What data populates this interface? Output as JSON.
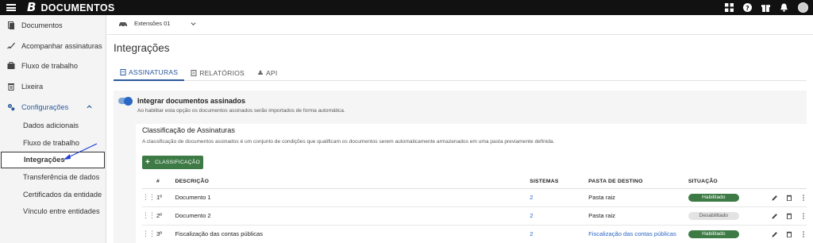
{
  "topbar": {
    "app_name": "DOCUMENTOS",
    "logo_letter": "B",
    "icons": [
      "apps-grid-icon",
      "help-icon",
      "gift-icon",
      "bell-icon",
      "user-avatar"
    ]
  },
  "sidebar": {
    "items": [
      {
        "label": "Documentos",
        "icon": "document-icon"
      },
      {
        "label": "Acompanhar assinaturas",
        "icon": "signature-icon"
      },
      {
        "label": "Fluxo de trabalho",
        "icon": "workflow-icon"
      },
      {
        "label": "Lixeira",
        "icon": "trash-icon"
      },
      {
        "label": "Configurações",
        "icon": "gears-icon"
      }
    ],
    "sub_items": [
      "Dados adicionais",
      "Fluxo de trabalho",
      "Integrações",
      "Transferência de dados",
      "Certificados da entidade",
      "Vínculo entre entidades"
    ],
    "active_sub": "Integrações"
  },
  "extension_selector": {
    "value": "Extensões 01"
  },
  "page_title": "Integrações",
  "tabs": [
    {
      "label": "ASSINATURAS",
      "icon": "document-icon",
      "active": true
    },
    {
      "label": "RELATÓRIOS",
      "icon": "report-icon",
      "active": false
    },
    {
      "label": "API",
      "icon": "api-icon",
      "active": false
    }
  ],
  "integration": {
    "title": "Integrar documentos assinados",
    "description": "Ao habilitar esta opção os documentos assinados serão importados de forma automática.",
    "enabled": true
  },
  "classification": {
    "title": "Classificação de Assinaturas",
    "description": "A classificação de documentos assinados é um conjunto de condições que qualificam os documentos serem automaticamente armazenados em uma pasta previamente definida.",
    "add_button": "CLASSIFICAÇÃO"
  },
  "table": {
    "headers": {
      "num": "#",
      "description": "DESCRIÇÃO",
      "systems": "SISTEMAS",
      "destination": "PASTA DE DESTINO",
      "status": "SITUAÇÃO"
    },
    "rows": [
      {
        "num": "1º",
        "description": "Documento 1",
        "systems": "2",
        "destination": "Pasta raiz",
        "status": "Habilitado"
      },
      {
        "num": "2º",
        "description": "Documento 2",
        "systems": "2",
        "destination": "Pasta raiz",
        "status": "Desabilitado"
      },
      {
        "num": "3º",
        "description": "Fiscalização das contas públicas",
        "systems": "2",
        "destination": "Fiscalização das contas públicas",
        "status": "Habilitado"
      }
    ]
  },
  "colors": {
    "accent": "#2b5a9c",
    "success": "#3d7a45",
    "link": "#2b66c4"
  }
}
